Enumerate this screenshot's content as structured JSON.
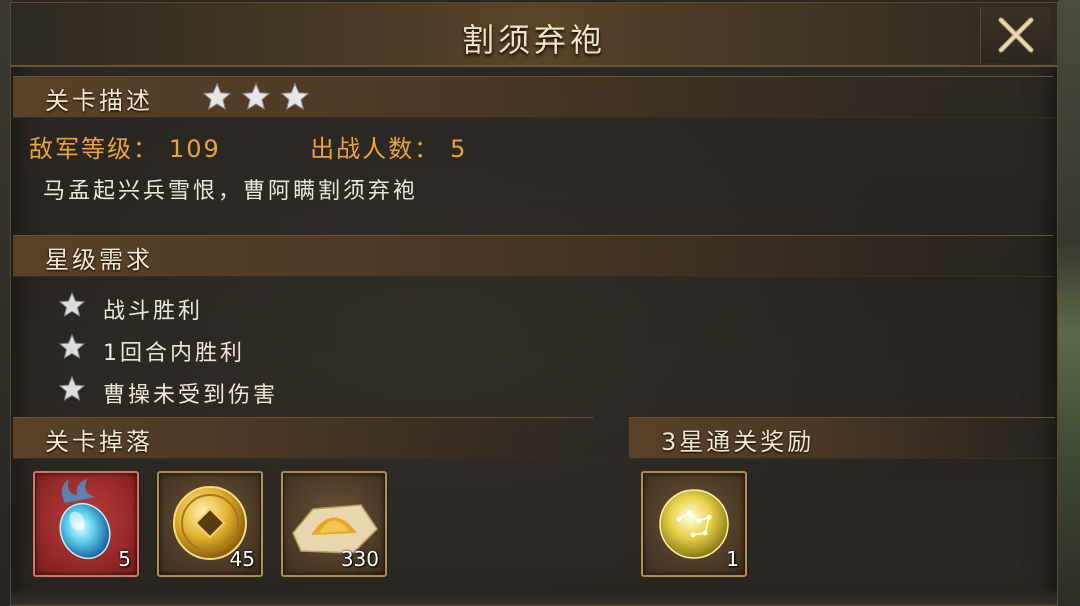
{
  "dialog": {
    "title": "割须弃袍"
  },
  "stage_info": {
    "section_label": "关卡描述",
    "stars_earned": 3,
    "enemy_level_label": "敌军等级：",
    "enemy_level": "109",
    "deploy_count_label": "出战人数：",
    "deploy_count": "5",
    "description": "马孟起兴兵雪恨，曹阿瞒割须弃袍"
  },
  "star_requirements": {
    "section_label": "星级需求",
    "items": [
      {
        "label": "战斗胜利",
        "icon": "star-icon"
      },
      {
        "label": "1回合内胜利",
        "icon": "star-icon"
      },
      {
        "label": "曹操未受到伤害",
        "icon": "star-icon"
      }
    ]
  },
  "drops": {
    "section_label": "关卡掉落",
    "items": [
      {
        "icon": "blue-soul-gem-icon",
        "count": "5",
        "rarity": "red"
      },
      {
        "icon": "gold-coin-icon",
        "count": "45",
        "rarity": "gold"
      },
      {
        "icon": "sand-pile-icon",
        "count": "330",
        "rarity": "gold"
      }
    ]
  },
  "rewards": {
    "section_label": "3星通关奖励",
    "items": [
      {
        "icon": "constellation-orb-icon",
        "count": "1",
        "rarity": "gold"
      }
    ]
  },
  "colors": {
    "accent_orange": "#e9a33c",
    "title_text": "#f1e2c1",
    "red_rarity": "#c23a3a"
  }
}
